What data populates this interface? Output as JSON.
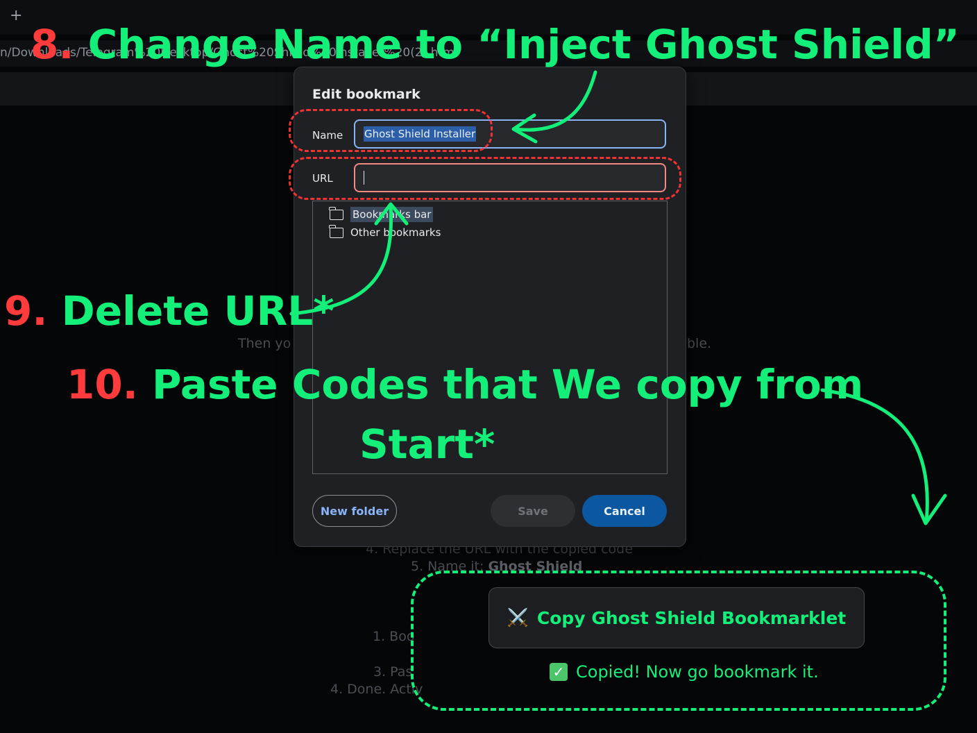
{
  "browser": {
    "new_tab_label": "+",
    "address_text": "n/Downloads/Telegram%20Desktop/Ghost%20Shield%20Installer%20(2).html"
  },
  "page": {
    "line_then": "Then yo",
    "line_then_end": "ble.",
    "step4": "4. Replace the URL with the copied code",
    "step5_prefix": "5. Name it:",
    "step5_bold": "Ghost Shield",
    "step1": "1. Boo",
    "step3": "3. Pas",
    "step4b": "4. Done. Activ"
  },
  "dialog": {
    "title": "Edit bookmark",
    "name_label": "Name",
    "name_value": "Ghost Shield Installer",
    "url_label": "URL",
    "url_value": "",
    "folders": [
      "Bookmarks bar",
      "Other bookmarks"
    ],
    "new_folder_label": "New folder",
    "save_label": "Save",
    "cancel_label": "Cancel"
  },
  "annotations": {
    "step8_num": "8.",
    "step8_text": "Change Name to “Inject Ghost Shield”",
    "step9_num": "9.",
    "step9_text": "Delete URL*",
    "step10_num": "10.",
    "step10_text": "Paste Codes that We copy from",
    "step10_text2": "Start*"
  },
  "bookmarklet": {
    "button_icon": "⚔️",
    "button_label": "Copy Ghost Shield Bookmarklet",
    "copied_icon": "✓",
    "copied_text": "Copied! Now go bookmark it."
  },
  "colors": {
    "annotation_green": "#14ef7a",
    "annotation_red": "#ff3b3b",
    "dialog_bg": "#1f2023",
    "focus_blue": "#8ab4f8",
    "cancel_blue": "#0b57a0"
  }
}
